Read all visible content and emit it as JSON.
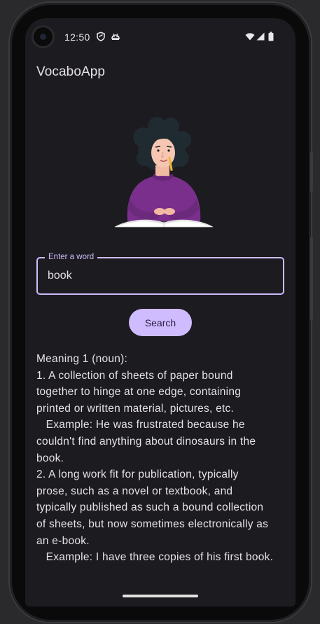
{
  "status_bar": {
    "time": "12:50",
    "left_icons": [
      "shield-icon",
      "android-head-icon"
    ],
    "right_icons": [
      "wifi-icon",
      "signal-icon",
      "battery-icon"
    ]
  },
  "app": {
    "title": "VocaboApp"
  },
  "illustration": {
    "description_icon": "person-reading-book-illustration"
  },
  "search": {
    "label": "Enter a word",
    "value": "book",
    "button_label": "Search"
  },
  "result": {
    "text": "Meaning 1 (noun):\n1. A collection of sheets of paper bound\ntogether to hinge at one edge, containing\nprinted or written material, pictures, etc.\n   Example: He was frustrated because he\ncouldn't find anything about dinosaurs in the\nbook.\n2. A long work fit for publication, typically\nprose, such as a novel or textbook, and\ntypically published as such a bound collection\nof sheets, but now sometimes electronically as\nan e-book.\n   Example: I have three copies of his first book."
  },
  "colors": {
    "background": "#1c1b1f",
    "accent": "#cfbcff",
    "text": "#e6e1e5",
    "sweater": "#7a2f8c"
  }
}
